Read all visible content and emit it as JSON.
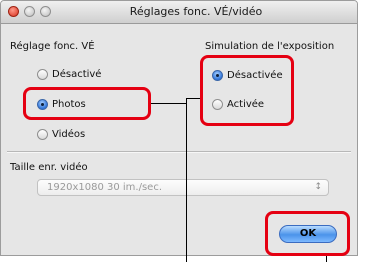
{
  "window": {
    "title": "Réglages fonc. VÉ/vidéo"
  },
  "groups": {
    "live_view": {
      "label": "Réglage fonc. VÉ",
      "options": [
        {
          "label": "Désactivé",
          "selected": false
        },
        {
          "label": "Photos",
          "selected": true
        },
        {
          "label": "Vidéos",
          "selected": false
        }
      ]
    },
    "exposure_simulation": {
      "label": "Simulation de l'exposition",
      "options": [
        {
          "label": "Désactivée",
          "selected": true
        },
        {
          "label": "Activée",
          "selected": false
        }
      ]
    }
  },
  "video_size": {
    "label": "Taille enr. vidéo",
    "selected_value": "1920x1080 30 im./sec.",
    "enabled": false
  },
  "buttons": {
    "ok_label": "OK"
  },
  "colors": {
    "callout": "#e50012",
    "accent": "#3b7fe0"
  },
  "icons": {
    "radio_selected": "radio-selected-icon",
    "radio_unselected": "radio-unselected-icon",
    "select_arrows": "up-down-arrows-icon"
  }
}
